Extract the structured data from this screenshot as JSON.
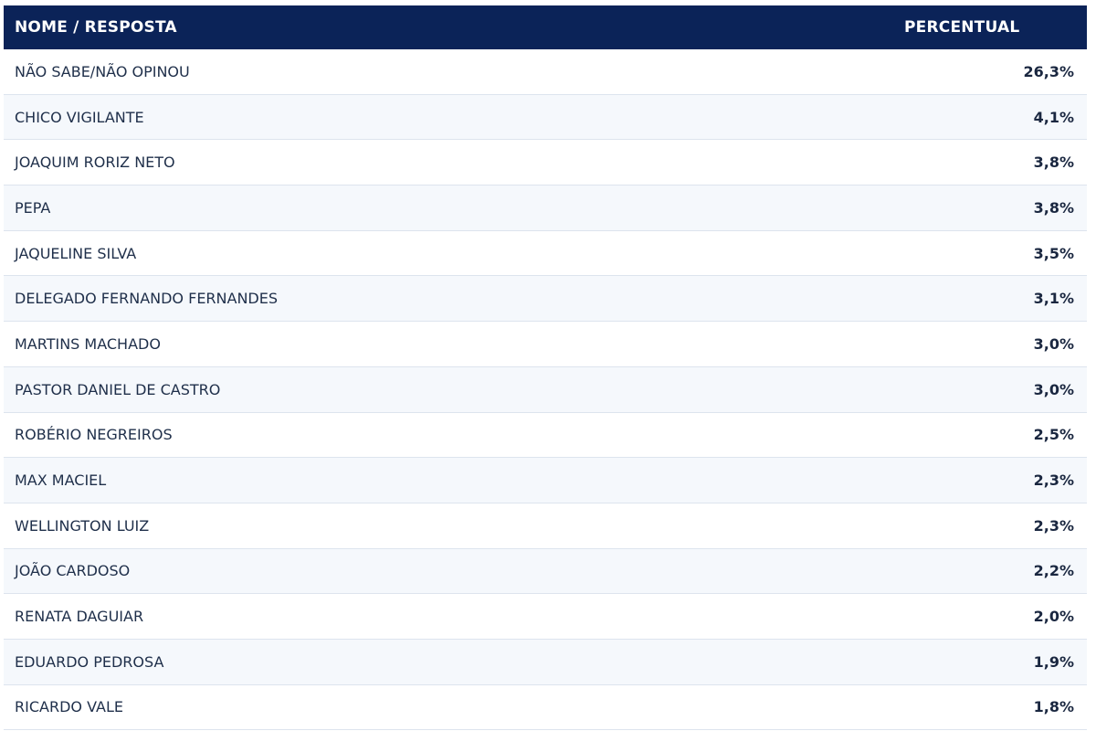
{
  "colors": {
    "header_bg": "#0b2358",
    "header_text": "#ffffff",
    "row_alt_bg": "#f5f8fc",
    "row_border": "#dde4ee"
  },
  "chart_data": {
    "type": "table",
    "columns": [
      "NOME / RESPOSTA",
      "PERCENTUAL"
    ],
    "rows": [
      {
        "name": "NÃO SABE/NÃO OPINOU",
        "value": 26.3,
        "label": "26,3%"
      },
      {
        "name": "CHICO VIGILANTE",
        "value": 4.1,
        "label": "4,1%"
      },
      {
        "name": "JOAQUIM RORIZ NETO",
        "value": 3.8,
        "label": "3,8%"
      },
      {
        "name": "PEPA",
        "value": 3.8,
        "label": "3,8%"
      },
      {
        "name": "JAQUELINE SILVA",
        "value": 3.5,
        "label": "3,5%"
      },
      {
        "name": "DELEGADO FERNANDO FERNANDES",
        "value": 3.1,
        "label": "3,1%"
      },
      {
        "name": "MARTINS MACHADO",
        "value": 3.0,
        "label": "3,0%"
      },
      {
        "name": "PASTOR DANIEL DE CASTRO",
        "value": 3.0,
        "label": "3,0%"
      },
      {
        "name": "ROBÉRIO NEGREIROS",
        "value": 2.5,
        "label": "2,5%"
      },
      {
        "name": "MAX MACIEL",
        "value": 2.3,
        "label": "2,3%"
      },
      {
        "name": "WELLINGTON LUIZ",
        "value": 2.3,
        "label": "2,3%"
      },
      {
        "name": "JOÃO CARDOSO",
        "value": 2.2,
        "label": "2,2%"
      },
      {
        "name": "RENATA DAGUIAR",
        "value": 2.0,
        "label": "2,0%"
      },
      {
        "name": "EDUARDO PEDROSA",
        "value": 1.9,
        "label": "1,9%"
      },
      {
        "name": "RICARDO VALE",
        "value": 1.8,
        "label": "1,8%"
      }
    ]
  }
}
